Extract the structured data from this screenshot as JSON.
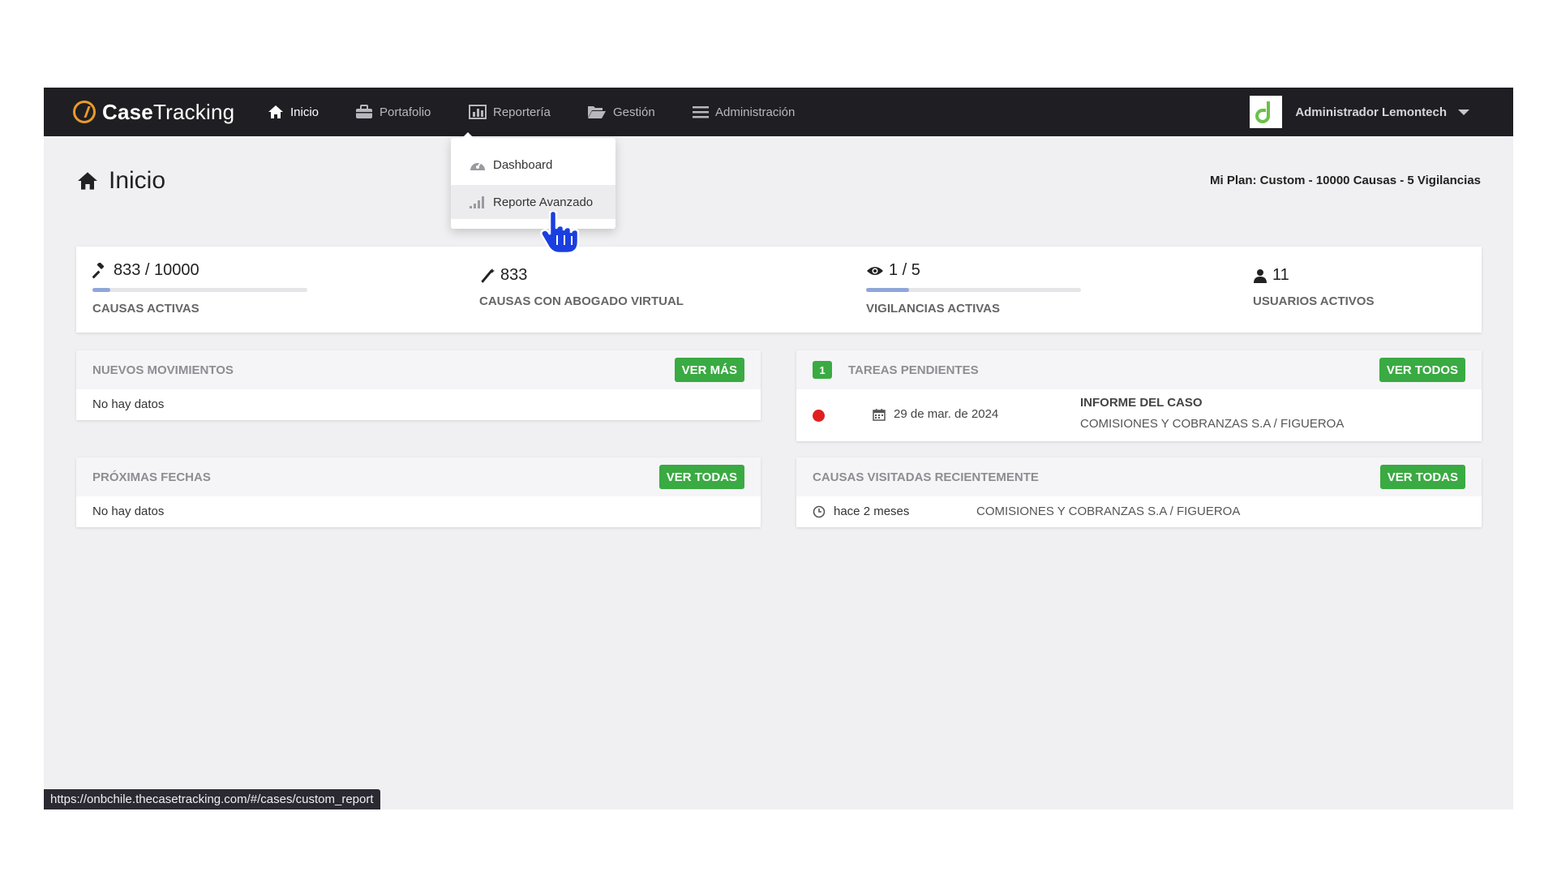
{
  "app": {
    "brand_bold": "Case",
    "brand_rest": "Tracking"
  },
  "nav": {
    "items": [
      {
        "label": "Inicio",
        "icon": "home-icon",
        "active": true
      },
      {
        "label": "Portafolio",
        "icon": "briefcase-icon"
      },
      {
        "label": "Reportería",
        "icon": "bar-chart-icon"
      },
      {
        "label": "Gestión",
        "icon": "folder-open-icon"
      },
      {
        "label": "Administración",
        "icon": "menu-icon"
      }
    ],
    "user": {
      "name": "Administrador Lemontech"
    }
  },
  "dropdown": {
    "items": [
      {
        "label": "Dashboard",
        "icon": "dashboard-icon"
      },
      {
        "label": "Reporte Avanzado",
        "icon": "signal-bars-icon"
      }
    ]
  },
  "page": {
    "title": "Inicio",
    "plan": "Mi Plan: Custom - 10000 Causas - 5 Vigilancias"
  },
  "stats": [
    {
      "value": "833 / 10000",
      "label": "CAUSAS ACTIVAS",
      "icon": "gavel-icon",
      "progress": 0.083
    },
    {
      "value": "833",
      "label": "CAUSAS CON ABOGADO VIRTUAL",
      "icon": "magic-wand-icon"
    },
    {
      "value": "1 / 5",
      "label": "VIGILANCIAS ACTIVAS",
      "icon": "eye-icon",
      "progress": 0.2
    },
    {
      "value": "11",
      "label": "USUARIOS ACTIVOS",
      "icon": "user-icon"
    }
  ],
  "panels": {
    "movimientos": {
      "title": "NUEVOS MOVIMIENTOS",
      "button": "VER MÁS",
      "empty": "No hay datos"
    },
    "fechas": {
      "title": "PRÓXIMAS FECHAS",
      "button": "VER TODAS",
      "empty": "No hay datos"
    },
    "tareas": {
      "count": "1",
      "title": "TAREAS PENDIENTES",
      "button": "VER TODOS",
      "items": [
        {
          "date": "29 de mar. de 2024",
          "title": "INFORME DEL CASO",
          "case": "COMISIONES Y COBRANZAS S.A / FIGUEROA",
          "status_color": "#e02020"
        }
      ]
    },
    "visitadas": {
      "title": "CAUSAS VISITADAS RECIENTEMENTE",
      "button": "VER TODAS",
      "items": [
        {
          "time": "hace 2 meses",
          "case": "COMISIONES Y COBRANZAS S.A / FIGUEROA"
        }
      ]
    }
  },
  "statusbar": {
    "url": "https://onbchile.thecasetracking.com/#/cases/custom_report"
  },
  "colors": {
    "accent_green": "#3aaa42",
    "navbar": "#1f1f23",
    "brand_orange": "#e99a2c",
    "progress": "#8fa6d8"
  }
}
